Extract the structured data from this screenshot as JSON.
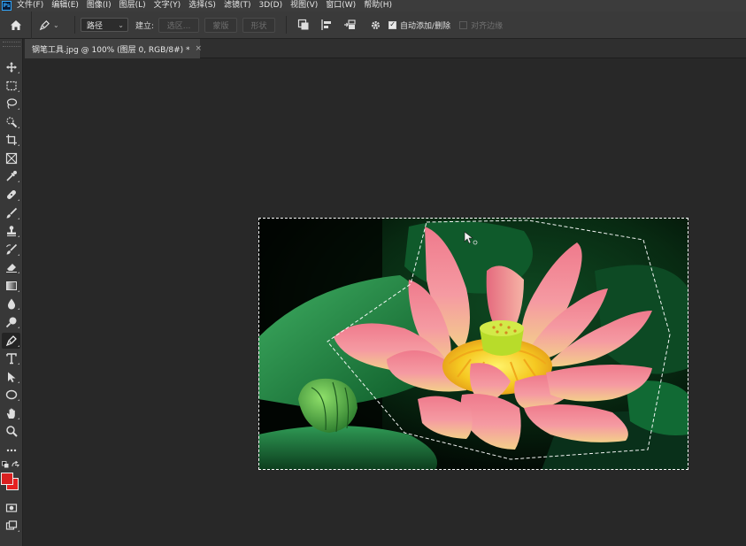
{
  "app": {
    "logo": "Ps"
  },
  "menu": [
    "文件(F)",
    "编辑(E)",
    "图像(I)",
    "图层(L)",
    "文字(Y)",
    "选择(S)",
    "滤镜(T)",
    "3D(D)",
    "视图(V)",
    "窗口(W)",
    "帮助(H)"
  ],
  "options": {
    "mode_select": "路径",
    "make_label": "建立:",
    "selection_btn": "选区...",
    "mask_btn": "蒙版",
    "shape_btn": "形状",
    "auto_add_delete": {
      "label": "自动添加/删除",
      "checked": true
    },
    "align_edges": {
      "label": "对齐边缘",
      "checked": false
    }
  },
  "document": {
    "tab_title": "钢笔工具.jpg @ 100% (图层 0, RGB/8#) *",
    "close_glyph": "×"
  },
  "colors": {
    "foreground": "#d92020",
    "background": "#e62020",
    "selection": "#ffffff"
  },
  "toolbar_icons": [
    "move-icon",
    "marquee-icon",
    "lasso-icon",
    "quick-select-icon",
    "crop-icon",
    "frame-icon",
    "eyedropper-icon",
    "healing-icon",
    "brush-icon",
    "stamp-icon",
    "history-brush-icon",
    "eraser-icon",
    "gradient-icon",
    "blur-icon",
    "dodge-icon",
    "pen-icon",
    "type-icon",
    "path-select-icon",
    "ellipse-icon",
    "hand-icon",
    "zoom-icon",
    "more-icon"
  ]
}
